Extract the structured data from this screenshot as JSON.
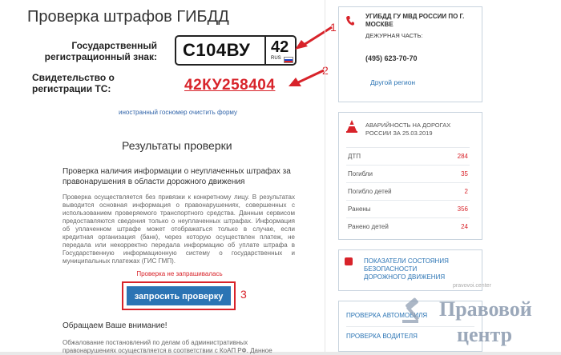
{
  "header": {
    "title": "Проверка штрафов ГИБДД"
  },
  "form": {
    "plate_label": "Государственный регистрационный знак:",
    "plate_number": "С104ВУ",
    "plate_region": "42",
    "plate_country": "RUS",
    "cert_label": "Свидетельство о регистрации ТС:",
    "cert_number": "42КУ258404",
    "links": "иностранный госномер очистить форму",
    "annotations": [
      "1",
      "2",
      "3"
    ]
  },
  "results": {
    "title": "Результаты проверки",
    "subtitle": "Проверка наличия информации о неуплаченных штрафах за правонарушения в области дорожного движения",
    "body": "Проверка осуществляется без привязки к конкретному лицу. В результатах выводится основная информация о правонарушениях, совершенных с использованием проверяемого транспортного средства. Данным сервисом предоставляются сведения только о неуплаченных штрафах. Информация об уплаченном штрафе может отображаться только в случае, если кредитная организация (банк), через которую осуществлен платеж, не передала или некорректно передала информацию об уплате штрафа в Государственную информационную систему о государственных и муниципальных платежах (ГИС ГМП).",
    "status": "Проверка не запрашивалась",
    "button": "запросить проверку",
    "notice": "Обращаем Ваше внимание!",
    "footer": "Обжалование постановлений по делам об административных правонарушениях осуществляется в соответствии с КоАП РФ. Данное"
  },
  "sidebar": {
    "gibdd_title": "УГИБДД ГУ МВД РОССИИ ПО Г. МОСКВЕ",
    "duty_label": "ДЕЖУРНАЯ ЧАСТЬ:",
    "phone": "(495) 623-70-70",
    "region_link": "Другой регион",
    "accidents_title": "АВАРИЙНОСТЬ НА ДОРОГАХ РОССИИ ЗА 25.03.2019",
    "stats": [
      {
        "label": "ДТП",
        "value": "284"
      },
      {
        "label": "Погибли",
        "value": "35"
      },
      {
        "label": "Погибло детей",
        "value": "2"
      },
      {
        "label": "Ранены",
        "value": "356"
      },
      {
        "label": "Ранено детей",
        "value": "24"
      }
    ],
    "indicators_link": "ПОКАЗАТЕЛИ СОСТОЯНИЯ БЕЗОПАСНОСТИ ДОРОЖНОГО ДВИЖЕНИЯ",
    "watermark_small": "pravovoi.center",
    "check_links": [
      "ПРОВЕРКА АВТОМОБИЛЯ",
      "ПРОВЕРКА ВОДИТЕЛЯ"
    ]
  },
  "watermark": {
    "line1": "Правовой",
    "line2": "центр"
  },
  "colors": {
    "accent_red": "#d8232a",
    "link_blue": "#2b74b4",
    "button_blue": "#2b74b4",
    "watermark": "#8a9aae"
  }
}
